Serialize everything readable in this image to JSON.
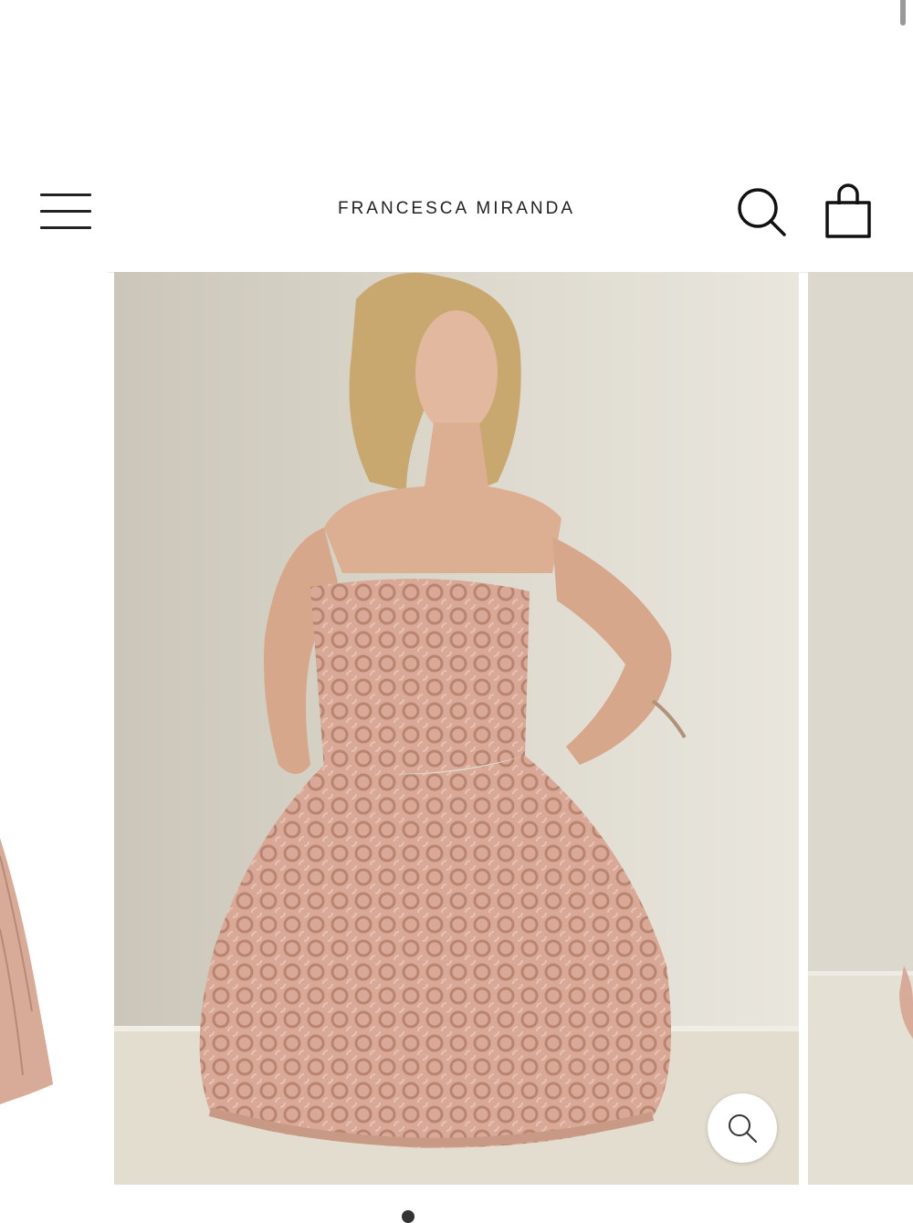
{
  "brand": {
    "name": "FRANCESCA MIRANDA"
  },
  "header": {
    "menu_icon": "hamburger-menu-icon",
    "search_icon": "search-icon",
    "cart_icon": "shopping-bag-icon"
  },
  "gallery": {
    "zoom_icon": "zoom-search-icon",
    "current_slide": 1
  },
  "colors": {
    "text": "#222222",
    "dress": "#c99a86",
    "wall": "#d4cfc3"
  }
}
